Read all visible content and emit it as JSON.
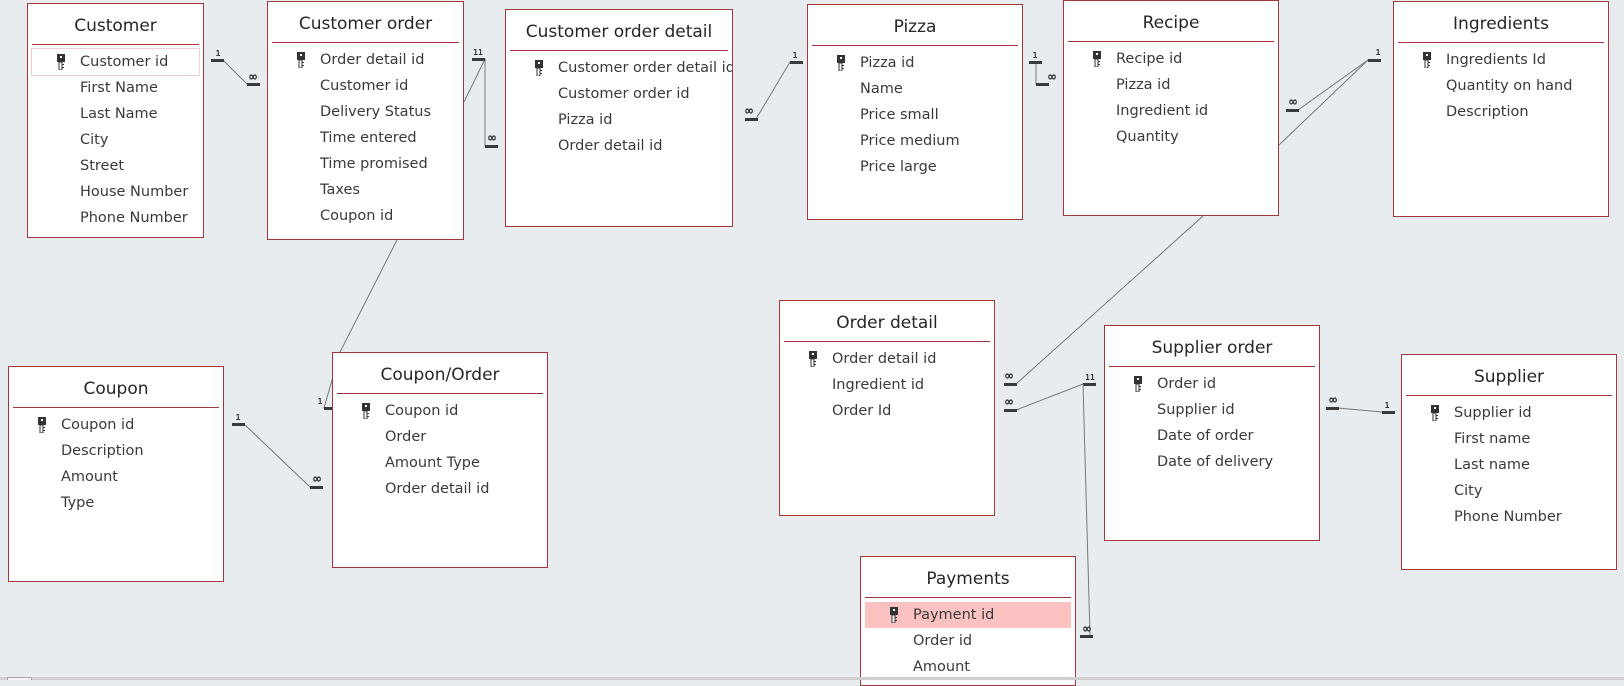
{
  "diagram": {
    "type": "relationships",
    "tables": [
      {
        "id": "customer",
        "name": "Customer",
        "fields": [
          {
            "name": "Customer id",
            "pk": true
          },
          {
            "name": "First Name"
          },
          {
            "name": "Last Name"
          },
          {
            "name": "City"
          },
          {
            "name": "Street"
          },
          {
            "name": "House Number"
          },
          {
            "name": "Phone Number"
          }
        ]
      },
      {
        "id": "customer_order",
        "name": "Customer order",
        "fields": [
          {
            "name": "Order detail id",
            "pk": true
          },
          {
            "name": "Customer id"
          },
          {
            "name": "Delivery Status"
          },
          {
            "name": "Time entered"
          },
          {
            "name": "Time promised"
          },
          {
            "name": "Taxes"
          },
          {
            "name": "Coupon id"
          }
        ]
      },
      {
        "id": "customer_order_detail",
        "name": "Customer order detail",
        "fields": [
          {
            "name": "Customer order detail id",
            "pk": true
          },
          {
            "name": "Customer order id"
          },
          {
            "name": "Pizza id"
          },
          {
            "name": "Order detail id"
          }
        ]
      },
      {
        "id": "pizza",
        "name": "Pizza",
        "fields": [
          {
            "name": "Pizza id",
            "pk": true
          },
          {
            "name": "Name"
          },
          {
            "name": "Price small"
          },
          {
            "name": "Price medium"
          },
          {
            "name": "Price large"
          }
        ]
      },
      {
        "id": "recipe",
        "name": "Recipe",
        "fields": [
          {
            "name": "Recipe id",
            "pk": true
          },
          {
            "name": "Pizza id"
          },
          {
            "name": "Ingredient id"
          },
          {
            "name": "Quantity"
          }
        ]
      },
      {
        "id": "ingredients",
        "name": "Ingredients",
        "fields": [
          {
            "name": "Ingredients Id",
            "pk": true
          },
          {
            "name": "Quantity on hand"
          },
          {
            "name": "Description"
          }
        ]
      },
      {
        "id": "coupon",
        "name": "Coupon",
        "fields": [
          {
            "name": "Coupon id",
            "pk": true
          },
          {
            "name": "Description"
          },
          {
            "name": "Amount"
          },
          {
            "name": "Type"
          }
        ]
      },
      {
        "id": "coupon_order",
        "name": "Coupon/Order",
        "fields": [
          {
            "name": "Coupon id",
            "pk": true
          },
          {
            "name": "Order"
          },
          {
            "name": "Amount Type"
          },
          {
            "name": "Order detail id"
          }
        ]
      },
      {
        "id": "order_detail",
        "name": "Order detail",
        "fields": [
          {
            "name": "Order detail id",
            "pk": true
          },
          {
            "name": "Ingredient id"
          },
          {
            "name": "Order Id"
          }
        ]
      },
      {
        "id": "supplier_order",
        "name": "Supplier order",
        "fields": [
          {
            "name": "Order id",
            "pk": true
          },
          {
            "name": "Supplier id"
          },
          {
            "name": "Date of order"
          },
          {
            "name": "Date of delivery"
          }
        ]
      },
      {
        "id": "supplier",
        "name": "Supplier",
        "fields": [
          {
            "name": "Supplier id",
            "pk": true
          },
          {
            "name": "First name"
          },
          {
            "name": "Last name"
          },
          {
            "name": "City"
          },
          {
            "name": "Phone Number"
          }
        ]
      },
      {
        "id": "payments",
        "name": "Payments",
        "fields": [
          {
            "name": "Payment id",
            "pk": true,
            "selected": true
          },
          {
            "name": "Order id"
          },
          {
            "name": "Amount"
          }
        ]
      }
    ],
    "relationships": [
      {
        "from": "customer",
        "to": "customer_order",
        "from_label": "1",
        "to_label": "∞"
      },
      {
        "from": "customer_order",
        "to": "customer_order_detail",
        "from_label": "1",
        "to_label": "∞"
      },
      {
        "from": "customer_order_detail",
        "to": "pizza",
        "from_label": "∞",
        "to_label": "1"
      },
      {
        "from": "pizza",
        "to": "recipe",
        "from_label": "1",
        "to_label": "∞"
      },
      {
        "from": "recipe",
        "to": "ingredients",
        "from_label": "∞",
        "to_label": "1"
      },
      {
        "from": "ingredients",
        "to": "order_detail",
        "from_label": "1",
        "to_label": "∞"
      },
      {
        "from": "customer_order",
        "to": "coupon_order",
        "from_label": "1",
        "to_label": "1"
      },
      {
        "from": "coupon",
        "to": "coupon_order",
        "from_label": "1",
        "to_label": "∞"
      },
      {
        "from": "supplier_order",
        "to": "order_detail",
        "from_label": "1",
        "to_label": "∞"
      },
      {
        "from": "supplier_order",
        "to": "payments",
        "from_label": "1",
        "to_label": "∞"
      },
      {
        "from": "supplier_order",
        "to": "supplier",
        "from_label": "∞",
        "to_label": "1"
      }
    ]
  },
  "colors": {
    "border": "#a4373a",
    "selected_row": "#fcc2c2",
    "canvas": "#e9ecef",
    "line": "#777777"
  }
}
